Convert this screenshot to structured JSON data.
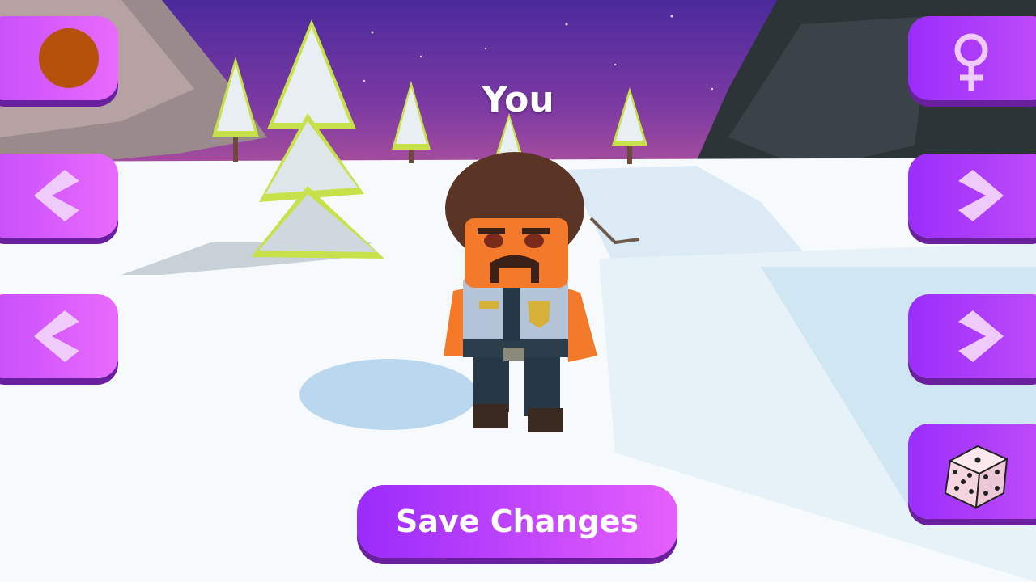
{
  "player": {
    "name": "You"
  },
  "actions": {
    "save_label": "Save Changes"
  },
  "color_picker": {
    "current_color": "#b5510a"
  },
  "gender_toggle": {
    "icon": "female-symbol-icon"
  },
  "randomize": {
    "icon": "dice-icon"
  },
  "palette": {
    "button_gradient": [
      "#9a2bfb",
      "#e55ffb"
    ],
    "button_shadow": "#6a1f9e",
    "arrow": "#eecbfb"
  }
}
